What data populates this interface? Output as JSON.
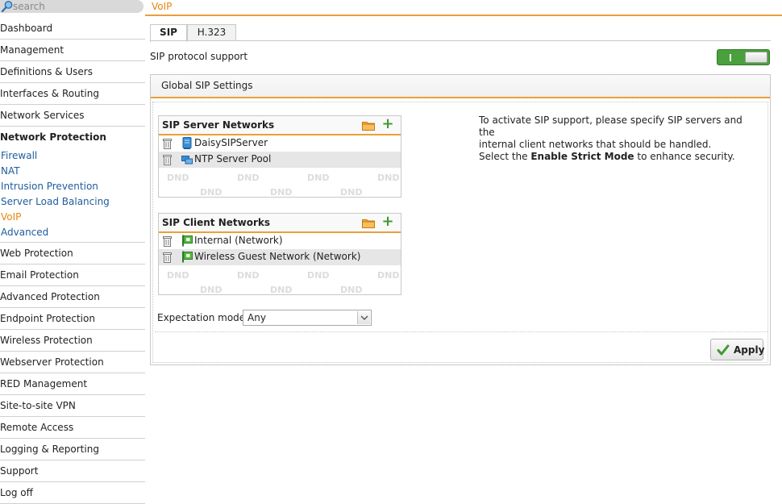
{
  "search": {
    "placeholder": "search"
  },
  "breadcrumb": "VoIP",
  "sidebar": {
    "items": [
      {
        "label": "Dashboard"
      },
      {
        "label": "Management"
      },
      {
        "label": "Definitions & Users"
      },
      {
        "label": "Interfaces & Routing"
      },
      {
        "label": "Network Services"
      },
      {
        "label": "Network Protection"
      },
      {
        "label": "Web Protection"
      },
      {
        "label": "Email Protection"
      },
      {
        "label": "Advanced Protection"
      },
      {
        "label": "Endpoint Protection"
      },
      {
        "label": "Wireless Protection"
      },
      {
        "label": "Webserver Protection"
      },
      {
        "label": "RED Management"
      },
      {
        "label": "Site-to-site VPN"
      },
      {
        "label": "Remote Access"
      },
      {
        "label": "Logging & Reporting"
      },
      {
        "label": "Support"
      },
      {
        "label": "Log off"
      }
    ],
    "subitems": [
      {
        "label": "Firewall"
      },
      {
        "label": "NAT"
      },
      {
        "label": "Intrusion Prevention"
      },
      {
        "label": "Server Load Balancing"
      },
      {
        "label": "VoIP"
      },
      {
        "label": "Advanced"
      }
    ]
  },
  "tabs": [
    {
      "label": "SIP"
    },
    {
      "label": "H.323"
    }
  ],
  "protocol": {
    "label": "SIP protocol support",
    "enabled": true
  },
  "global": {
    "title": "Global SIP Settings"
  },
  "server_networks": {
    "title": "SIP Server Networks",
    "rows": [
      {
        "label": "DaisySIPServer"
      },
      {
        "label": "NTP Server Pool"
      }
    ]
  },
  "client_networks": {
    "title": "SIP Client Networks",
    "rows": [
      {
        "label": "Internal (Network)"
      },
      {
        "label": "Wireless Guest Network (Network)"
      }
    ]
  },
  "dnd_label": "DND",
  "info": {
    "line1": "To activate SIP support, please specify SIP servers and the",
    "line2": "internal client networks that should be handled.",
    "line3a": "Select the ",
    "line3b": "Enable Strict Mode",
    "line3c": " to enhance security."
  },
  "expectation": {
    "label": "Expectation mode:",
    "value": "Any"
  },
  "apply": {
    "label": "Apply"
  },
  "colors": {
    "accent": "#e8a03a",
    "link": "#1f5c9c",
    "active": "#e8860c",
    "toggle_on": "#4aa03c"
  }
}
